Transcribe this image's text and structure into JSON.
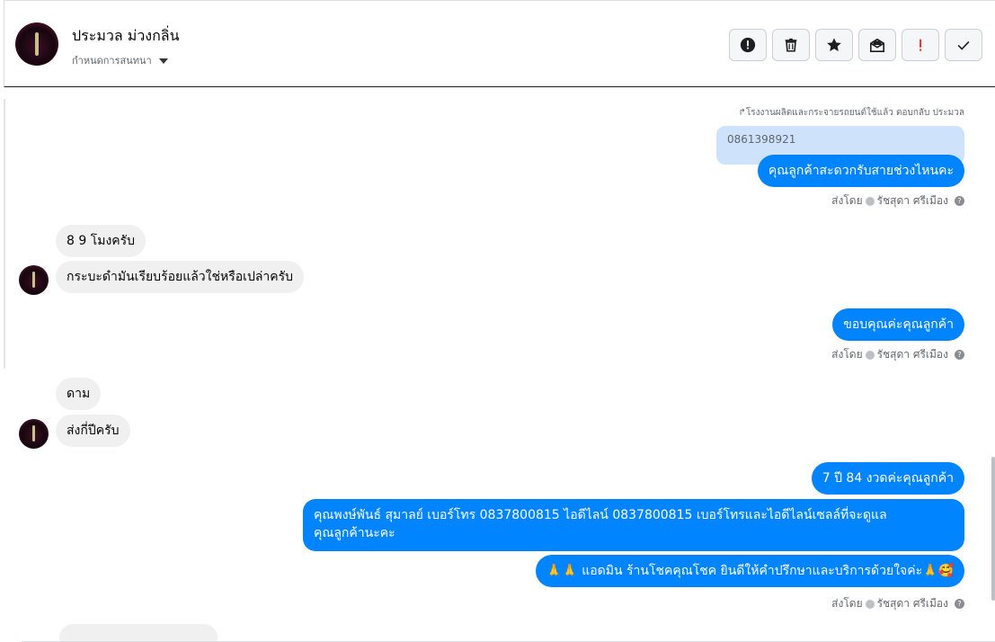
{
  "header": {
    "name": "ประมวล ม่วงกลิ่น",
    "assign_label": "กำหนดการสนทนา",
    "buttons": [
      {
        "name": "alert-button",
        "icon": "exclamation-circle-icon"
      },
      {
        "name": "delete-button",
        "icon": "trash-icon"
      },
      {
        "name": "star-button",
        "icon": "star-icon"
      },
      {
        "name": "mark-unread-button",
        "icon": "envelope-open-icon"
      },
      {
        "name": "spam-button",
        "icon": "exclamation-icon"
      },
      {
        "name": "done-button",
        "icon": "check-icon"
      }
    ]
  },
  "conversation": {
    "reply_note": "↱โรงงานผลิตและกระจายรถยนต์ใช้แล้ว ตอบกลับ ประมวล",
    "quoted": "0861398921",
    "messages": {
      "m1": "คุณลูกค้าสะดวกรับสายช่วงไหนคะ",
      "m2": "8 9 โมงครับ",
      "m3": "กระบะดำมันเรียบร้อยแล้วใช่หรือเปล่าครับ",
      "m4": "ขอบคุณค่ะคุณลูกค้า",
      "m5": "ดาม",
      "m6": "ส่งกี่ปีครับ",
      "m7": "7 ปี 84 งวดค่ะคุณลูกค้า",
      "m8_line1": "คุณพงษ์พันธ์ สุมาลย์      เบอร์โทร 0837800815  ไอดีไลน์ 0837800815   เบอร์โทรและไอดีไลน์เซลล์ที่จะดูแล",
      "m8_line2": "คุณลูกค้านะคะ",
      "m9": "🙏🙏 แอดมิน ร้านโชคคุณโชค ยินดีให้คำปรึกษาและบริการด้วยใจค่ะ🙏🥰"
    },
    "sent_by_label": "ส่งโดย",
    "sender": "รัชสุดา ศรีเมือง",
    "help_glyph": "?"
  },
  "colors": {
    "outgoing_bubble": "#0084ff",
    "incoming_bubble": "#f0f0f0",
    "quote_bg": "#cfe2fb"
  }
}
